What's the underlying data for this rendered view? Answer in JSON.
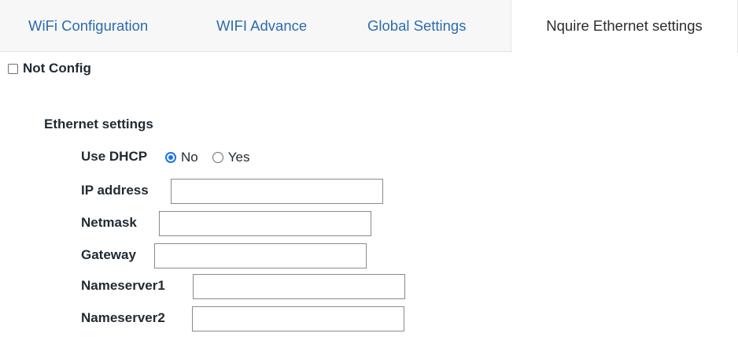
{
  "tabs": [
    {
      "label": "WiFi Configuration",
      "active": false
    },
    {
      "label": "WIFI Advance",
      "active": false
    },
    {
      "label": "Global Settings",
      "active": false
    },
    {
      "label": "Nquire Ethernet settings",
      "active": true
    }
  ],
  "not_config": {
    "label": "Not Config",
    "checked": false
  },
  "ethernet": {
    "section_title": "Ethernet settings",
    "use_dhcp": {
      "label": "Use DHCP",
      "options": [
        "No",
        "Yes"
      ],
      "selected": "No"
    },
    "fields": {
      "ip_address": {
        "label": "IP address",
        "value": ""
      },
      "netmask": {
        "label": "Netmask",
        "value": ""
      },
      "gateway": {
        "label": "Gateway",
        "value": ""
      },
      "nameserver1": {
        "label": "Nameserver1",
        "value": ""
      },
      "nameserver2": {
        "label": "Nameserver2",
        "value": ""
      }
    }
  },
  "colors": {
    "tab_link": "#2b6cb0",
    "active_tab_text": "#2c2c2c",
    "radio_accent": "#1a73e8"
  }
}
